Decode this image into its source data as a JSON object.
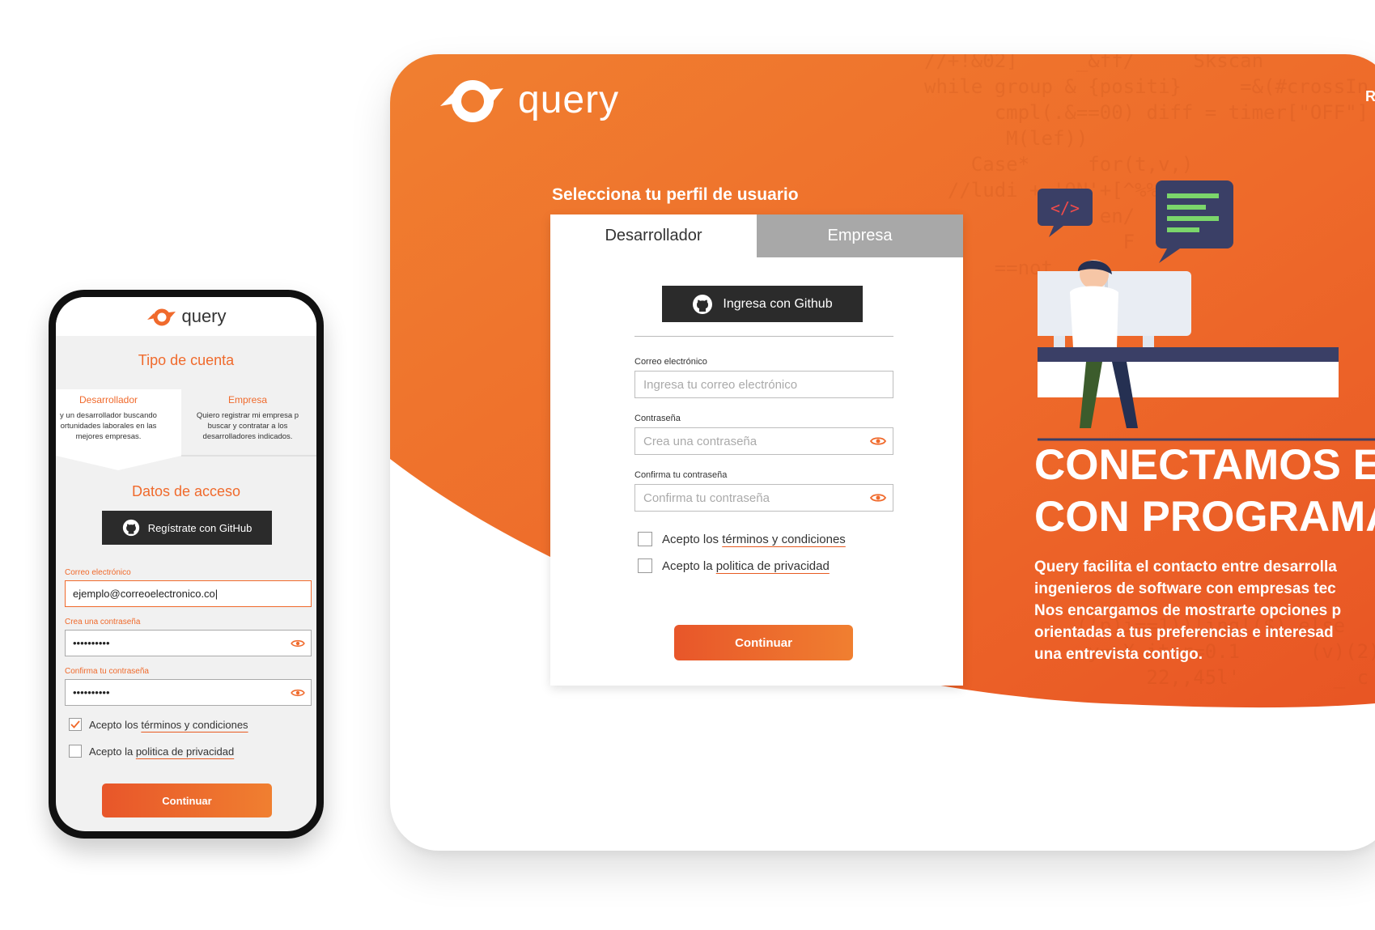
{
  "colors": {
    "brand_orange": "#f06a2c",
    "dark_button": "#2b2b2b",
    "tab_inactive": "#a8a8a8"
  },
  "desktop": {
    "brand": {
      "name": "query",
      "icon": "query-logo-icon"
    },
    "nav_partial": "R",
    "profile_title": "Selecciona tu perfil de usuario",
    "tabs": [
      {
        "label": "Desarrollador",
        "active": true
      },
      {
        "label": "Empresa",
        "active": false
      }
    ],
    "github_button": "Ingresa con Github",
    "email": {
      "label": "Correo electrónico",
      "placeholder": "Ingresa tu correo electrónico"
    },
    "password": {
      "label": "Contraseña",
      "placeholder": "Crea una contraseña"
    },
    "confirm": {
      "label": "Confirma tu contraseña",
      "placeholder": "Confirma tu contraseña"
    },
    "terms": {
      "prefix": "Acepto los ",
      "link": "términos y condiciones",
      "checked": false
    },
    "privacy": {
      "prefix": "Acepto la ",
      "link": "politica de privacidad",
      "checked": false
    },
    "continue_button": "Continuar",
    "hero_title": [
      "CONECTAMOS E",
      "CON PROGRAMA"
    ],
    "hero_body": [
      "Query facilita el contacto entre desarrolla",
      "ingenieros de software con empresas tec",
      "Nos encargamos de mostrarte opciones p",
      "orientadas a tus preferencias e interesad",
      "una entrevista contigo."
    ]
  },
  "mobile": {
    "brand": {
      "name": "query",
      "icon": "query-logo-icon"
    },
    "account_type_title": "Tipo de cuenta",
    "tabs": [
      {
        "label": "Desarrollador",
        "description": "y un desarrollador buscando\nortunidades laborales en las\nmejores empresas.",
        "active": true
      },
      {
        "label": "Empresa",
        "description": "Quiero registrar mi empresa p\nbuscar y contratar a los\ndesarrolladores indicados.",
        "active": false
      }
    ],
    "access_title": "Datos de acceso",
    "github_button": "Regístrate con GitHub",
    "email": {
      "label": "Correo electrónico",
      "value": "ejemplo@correoelectronico.co|"
    },
    "password": {
      "label": "Crea una contraseña",
      "value": "••••••••••"
    },
    "confirm": {
      "label": "Confirma tu contraseña",
      "value": "••••••••••"
    },
    "terms": {
      "prefix": "Acepto los ",
      "link": "términos y condiciones",
      "checked": true
    },
    "privacy": {
      "prefix": "Acepto la ",
      "link": "politica de privacidad",
      "checked": false
    },
    "continue_button": "Continuar"
  }
}
